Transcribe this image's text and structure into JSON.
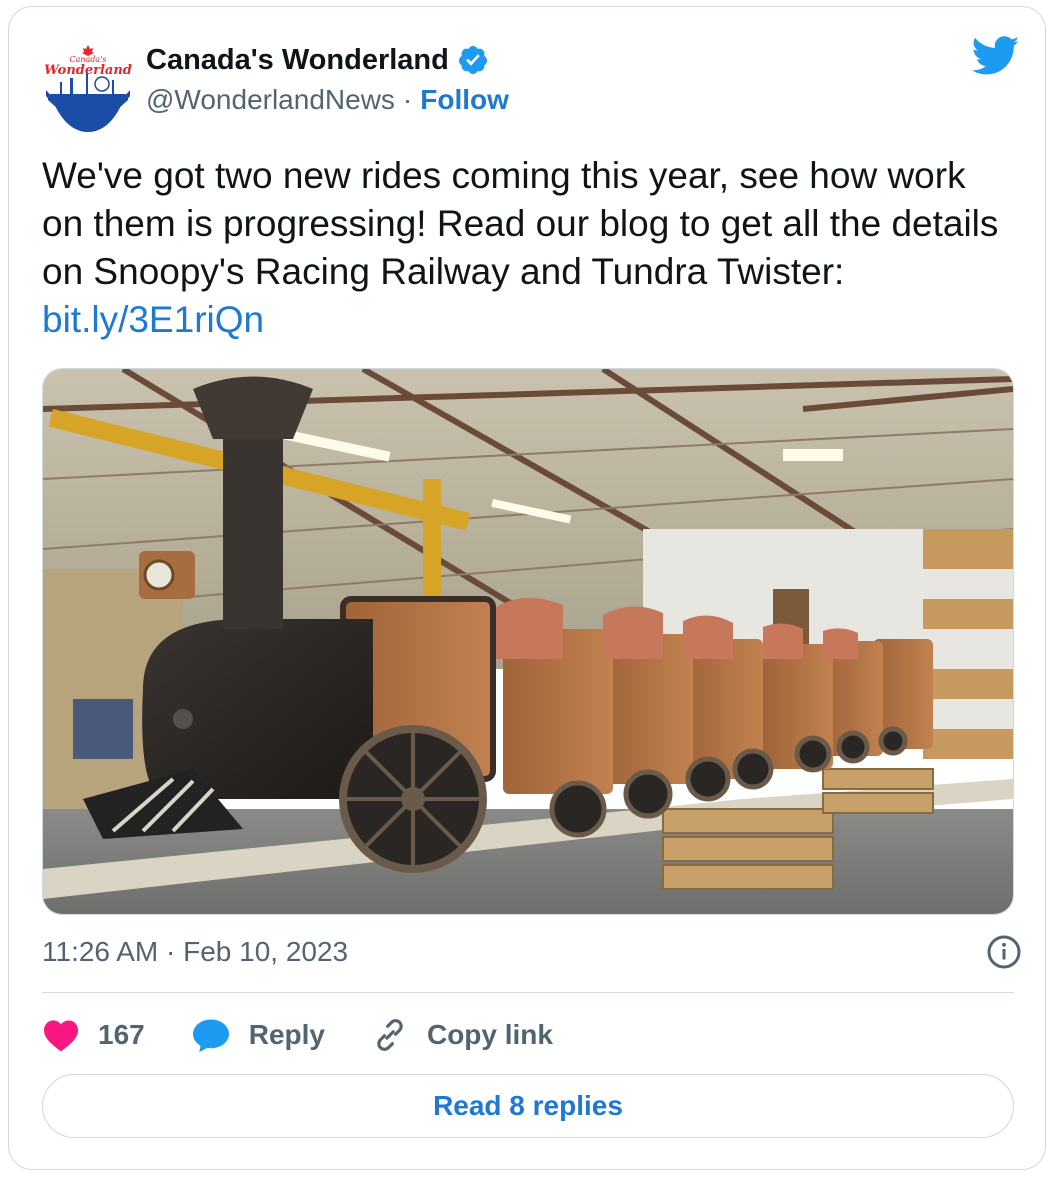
{
  "author": {
    "display_name": "Canada's Wonderland",
    "handle": "@WonderlandNews",
    "separator": "·",
    "follow_label": "Follow",
    "avatar_text_top": "Canada's",
    "avatar_text_main": "Wonderland"
  },
  "tweet": {
    "text": "We've got two new rides coming this year, see how work on them is progressing! Read our blog to get all the details on Snoopy's Racing Railway and Tundra Twister: ",
    "link": "bit.ly/3E1riQn",
    "timestamp": "11:26 AM · Feb 10, 2023"
  },
  "actions": {
    "likes": "167",
    "reply_label": "Reply",
    "copy_link_label": "Copy link"
  },
  "read_replies_label": "Read 8 replies",
  "colors": {
    "link": "#1d79d1",
    "like": "#f91880",
    "reply": "#1d9bf0",
    "twitter": "#1d9bf0",
    "secondary_text": "#536471",
    "border": "#cfd9de"
  },
  "icons": [
    "verified-badge-icon",
    "twitter-bird-icon",
    "info-icon",
    "heart-icon",
    "reply-bubble-icon",
    "link-icon"
  ]
}
